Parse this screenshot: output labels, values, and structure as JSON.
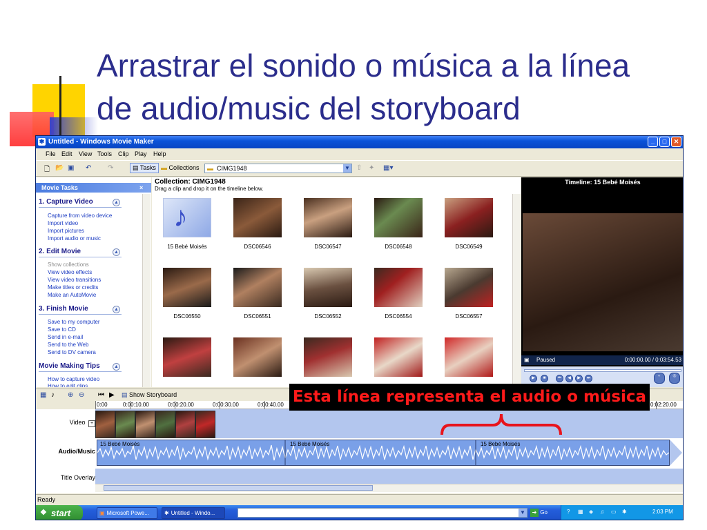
{
  "slide": {
    "title_line1": "Arrastrar el sonido o música a la línea",
    "title_line2": "de audio/music del storyboard",
    "accent_colors": [
      "#ffd400",
      "#ff3b3b",
      "#2b2d8c"
    ]
  },
  "window": {
    "title": "Untitled - Windows Movie Maker",
    "menu": [
      "File",
      "Edit",
      "View",
      "Tools",
      "Clip",
      "Play",
      "Help"
    ],
    "toolbar": {
      "tasks_label": "Tasks",
      "collections_label": "Collections",
      "collection_select_value": "CIMG1948"
    }
  },
  "movie_tasks": {
    "header": "Movie Tasks",
    "close_glyph": "×",
    "sections": [
      {
        "title": "1. Capture Video",
        "items": [
          "Capture from video device",
          "Import video",
          "Import pictures",
          "Import audio or music"
        ]
      },
      {
        "title": "2. Edit Movie",
        "items": [
          "Show collections",
          "View video effects",
          "View video transitions",
          "Make titles or credits",
          "Make an AutoMovie"
        ]
      },
      {
        "title": "3. Finish Movie",
        "items": [
          "Save to my computer",
          "Save to CD",
          "Send in e-mail",
          "Send to the Web",
          "Send to DV camera"
        ]
      },
      {
        "title": "Movie Making Tips",
        "items": [
          "How to capture video",
          "How to edit clips"
        ]
      }
    ]
  },
  "collection": {
    "title": "Collection: CIMG1948",
    "instructions": "Drag a clip and drop it on the timeline below.",
    "clips": [
      "15 Bebé Moisés",
      "DSC06546",
      "DSC06547",
      "DSC06548",
      "DSC06549",
      "DSC06550",
      "DSC06551",
      "DSC06552",
      "DSC06554",
      "DSC06557",
      "",
      "",
      "",
      "",
      ""
    ]
  },
  "preview": {
    "title": "Timeline: 15 Bebé Moisés",
    "status": "Paused",
    "time": "0:00:00.00 / 0:03:54.53"
  },
  "timeline": {
    "show_storyboard_label": "Show Storyboard",
    "ticks": [
      "0:00",
      "0:00:10.00",
      "0:00:20.00",
      "0:00:30.00",
      "0:00:40.00",
      "0:02:20.00"
    ],
    "track_labels": [
      "Video",
      "Audio/Music",
      "Title Overlay"
    ],
    "audio_clip_labels": [
      "15 Bebé Moisés",
      "15 Bebé Moisés",
      "15 Bebé Moisés"
    ]
  },
  "status_bar": "Ready",
  "taskbar": {
    "start_label": "start",
    "tasks": [
      "Microsoft Powe...",
      "Untitled - Windo..."
    ],
    "go_label": "Go",
    "clock": "2:03 PM"
  },
  "annotation": {
    "banner": "Esta línea representa el audio o música",
    "brace_color": "#e8141c"
  }
}
